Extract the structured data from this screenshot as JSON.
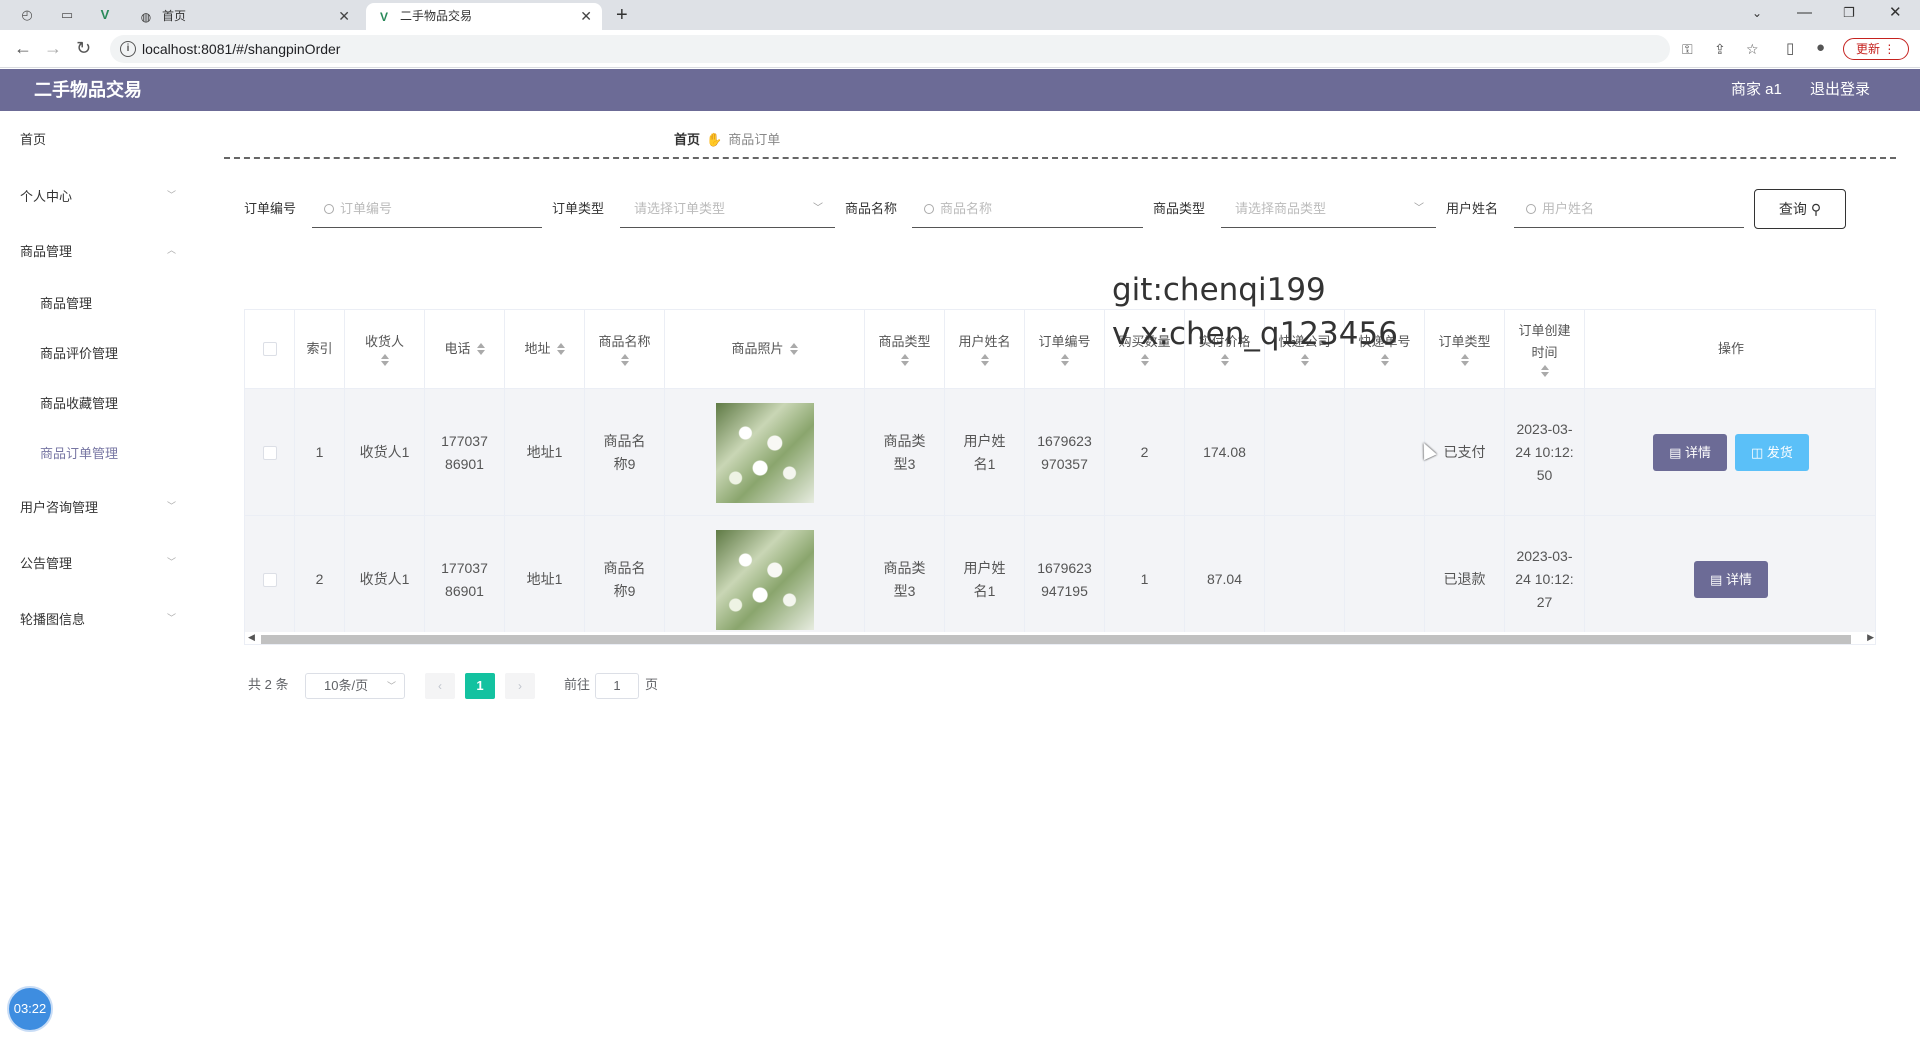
{
  "browser": {
    "tabs": [
      {
        "label": "首页",
        "favicon": "globe-icon"
      },
      {
        "label": "二手物品交易",
        "favicon": "vue-icon"
      }
    ],
    "url": "localhost:8081/#/shangpinOrder",
    "update_label": "更新"
  },
  "app": {
    "title": "二手物品交易",
    "user_label": "商家 a1",
    "logout_label": "退出登录",
    "accent_color": "#6c6b96"
  },
  "sidebar": {
    "items": [
      {
        "label": "首页"
      },
      {
        "label": "个人中心"
      },
      {
        "label": "商品管理"
      },
      {
        "label": "用户咨询管理"
      },
      {
        "label": "公告管理"
      },
      {
        "label": "轮播图信息"
      }
    ],
    "submenu": [
      {
        "label": "商品管理"
      },
      {
        "label": "商品评价管理"
      },
      {
        "label": "商品收藏管理"
      },
      {
        "label": "商品订单管理"
      }
    ]
  },
  "breadcrumb": {
    "home": "首页",
    "current": "商品订单"
  },
  "search": {
    "fields": [
      {
        "label": "订单编号",
        "placeholder": "订单编号"
      },
      {
        "label": "订单类型",
        "placeholder": "请选择订单类型"
      },
      {
        "label": "商品名称",
        "placeholder": "商品名称"
      },
      {
        "label": "商品类型",
        "placeholder": "请选择商品类型"
      },
      {
        "label": "用户姓名",
        "placeholder": "用户姓名"
      }
    ],
    "query_label": "查询"
  },
  "watermark": {
    "line1": "git:chenqi199",
    "line2": "v x:chen_q123456"
  },
  "table": {
    "headers": [
      "索引",
      "收货人",
      "电话",
      "地址",
      "商品名称",
      "商品照片",
      "商品类型",
      "用户姓名",
      "订单编号",
      "购买数量",
      "实付价格",
      "快递公司",
      "快递单号",
      "订单类型",
      "订单创建时间",
      "操作"
    ],
    "header_index": "索引",
    "header_receiver": "收货人",
    "header_phone": "电话",
    "header_address": "地址",
    "header_goods_name": "商品名称",
    "header_photo": "商品照片",
    "header_goods_type": "商品类型",
    "header_user": "用户姓名",
    "header_order_no": "订单编号",
    "header_qty": "购买数量",
    "header_price": "实付价格",
    "header_express": "快递公司",
    "header_express_no": "快递单号",
    "header_order_type": "订单类型",
    "header_created": "订单创建时间",
    "header_action": "操作",
    "rows": [
      {
        "index": "1",
        "receiver": "收货人1",
        "phone": "17703786901",
        "address": "地址1",
        "goods_name": "商品名称9",
        "goods_type": "商品类型3",
        "user": "用户姓名1",
        "order_no": "1679623970357",
        "qty": "2",
        "price": "174.08",
        "express": "",
        "express_no": "",
        "order_type": "已支付",
        "created": "2023-03-24 10:12:50",
        "detail_label": "详情",
        "ship_label": "发货"
      },
      {
        "index": "2",
        "receiver": "收货人1",
        "phone": "17703786901",
        "address": "地址1",
        "goods_name": "商品名称9",
        "goods_type": "商品类型3",
        "user": "用户姓名1",
        "order_no": "1679623947195",
        "qty": "1",
        "price": "87.04",
        "express": "",
        "express_no": "",
        "order_type": "已退款",
        "created": "2023-03-24 10:12:27",
        "detail_label": "详情"
      }
    ]
  },
  "pagination": {
    "total": "共 2 条",
    "page_size": "10条/页",
    "current_page": "1",
    "goto_label": "前往",
    "goto_value": "1",
    "page_suffix": "页"
  },
  "recorder": {
    "time": "03:22"
  }
}
